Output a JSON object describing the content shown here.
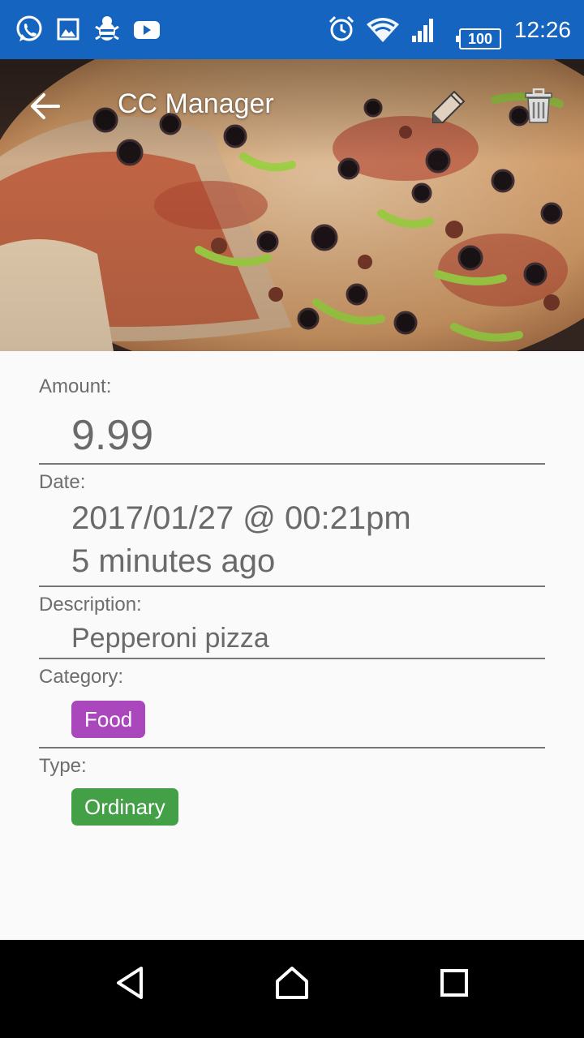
{
  "status_bar": {
    "time": "12:26",
    "battery": "100",
    "icons": [
      "whatsapp-icon",
      "gallery-icon",
      "bug-icon",
      "youtube-icon",
      "alarm-icon",
      "wifi-icon",
      "signal-icon",
      "battery-icon"
    ]
  },
  "toolbar": {
    "title": "CC Manager",
    "back_icon": "arrow-back-icon",
    "edit_icon": "pencil-icon",
    "delete_icon": "trash-icon"
  },
  "details": {
    "amount_label": "Amount:",
    "amount_value": "9.99",
    "date_label": "Date:",
    "date_value": "2017/01/27 @ 00:21pm",
    "date_relative": "5 minutes ago",
    "description_label": "Description:",
    "description_value": "Pepperoni pizza",
    "category_label": "Category:",
    "category_value": "Food",
    "type_label": "Type:",
    "type_value": "Ordinary"
  },
  "colors": {
    "status_bar": "#1565c0",
    "category_chip": "#ab47bc",
    "type_chip": "#43a047"
  },
  "nav_bar": {
    "icons": [
      "back-triangle-icon",
      "home-icon",
      "recents-icon"
    ]
  }
}
